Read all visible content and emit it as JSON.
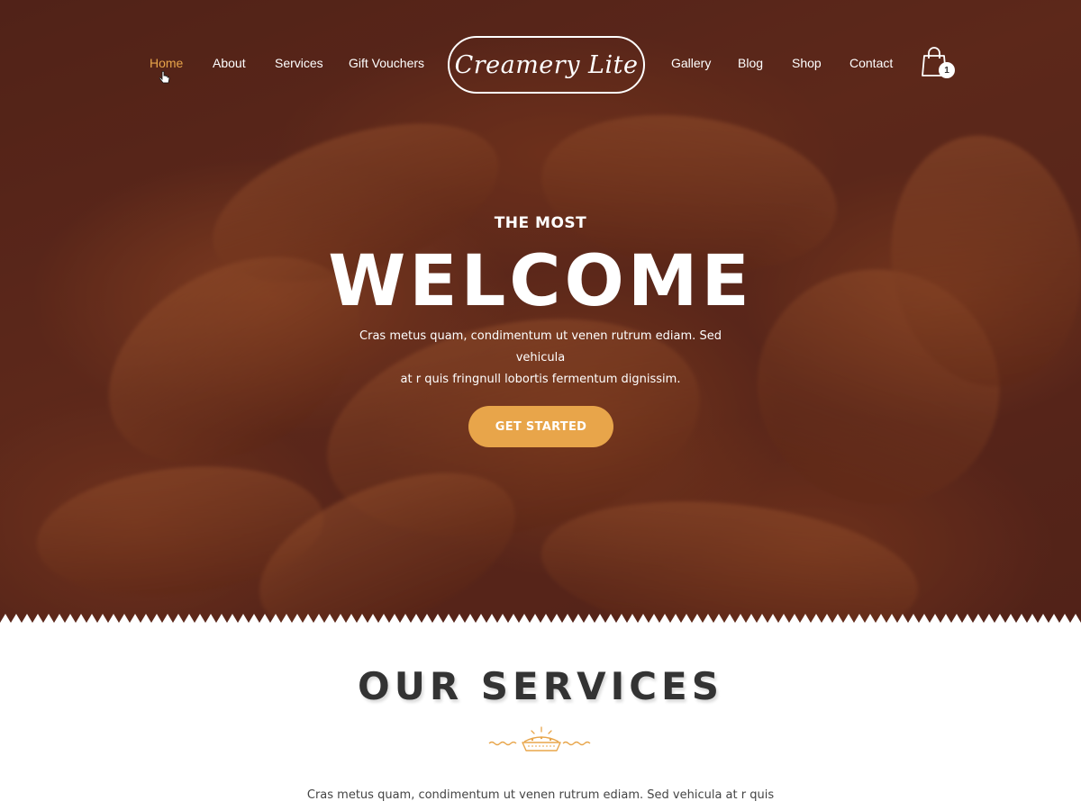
{
  "nav": {
    "left": [
      {
        "label": "Home",
        "active": true
      },
      {
        "label": "About"
      },
      {
        "label": "Services"
      },
      {
        "label": "Gift Vouchers"
      }
    ],
    "right": [
      {
        "label": "Gallery"
      },
      {
        "label": "Blog"
      },
      {
        "label": "Shop"
      },
      {
        "label": "Contact"
      }
    ],
    "logo": "Creamery Lite",
    "cart": {
      "icon": "shopping-bag-icon",
      "count": "1"
    }
  },
  "hero": {
    "eyebrow": "THE MOST",
    "headline": "WELCOME",
    "subtitle_line1": "Cras metus quam, condimentum ut venen rutrum ediam. Sed vehicula",
    "subtitle_line2": "at r quis fringnull lobortis fermentum dignissim.",
    "cta": "GET STARTED"
  },
  "services": {
    "title": "OUR SERVICES",
    "divider_icon": "pie-icon",
    "text": "Cras metus quam, condimentum ut venen rutrum ediam. Sed vehicula at r quis"
  },
  "colors": {
    "accent": "#e8a54a",
    "heading": "#333333",
    "overlay": "#46181 4"
  }
}
